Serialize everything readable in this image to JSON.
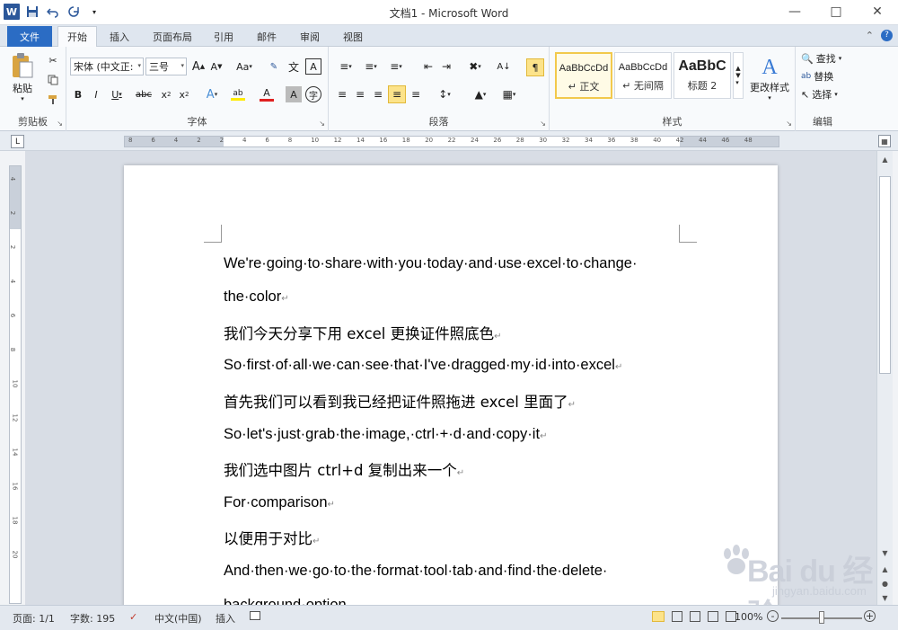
{
  "window": {
    "title": "文档1 - Microsoft Word"
  },
  "tabs": [
    {
      "label": "文件"
    },
    {
      "label": "开始"
    },
    {
      "label": "插入"
    },
    {
      "label": "页面布局"
    },
    {
      "label": "引用"
    },
    {
      "label": "邮件"
    },
    {
      "label": "审阅"
    },
    {
      "label": "视图"
    }
  ],
  "ribbon": {
    "clipboard": {
      "paste": "粘贴",
      "label": "剪贴板"
    },
    "font": {
      "family": "宋体 (中文正:",
      "size": "三号",
      "label": "字体",
      "case": "Aa"
    },
    "paragraph": {
      "label": "段落"
    },
    "styles": {
      "label": "样式",
      "items": [
        {
          "sample": "AaBbCcDd",
          "name": "↵ 正文"
        },
        {
          "sample": "AaBbCcDd",
          "name": "↵ 无间隔"
        },
        {
          "sample": "AaBbC",
          "name": "标题 2"
        }
      ],
      "change": "更改样式"
    },
    "editing": {
      "find": "查找",
      "replace": "替换",
      "select": "选择",
      "label": "编辑"
    }
  },
  "ruler": {
    "ticks": [
      "8",
      "6",
      "4",
      "2",
      "2",
      "4",
      "6",
      "8",
      "10",
      "12",
      "14",
      "16",
      "18",
      "20",
      "22",
      "24",
      "26",
      "28",
      "30",
      "32",
      "34",
      "36",
      "38",
      "40",
      "42",
      "44",
      "46",
      "48"
    ],
    "vticks": [
      "4",
      "2",
      "2",
      "4",
      "6",
      "8",
      "10",
      "12",
      "14",
      "16",
      "18",
      "20"
    ]
  },
  "document": {
    "lines": [
      "We're·going·to·share·with·you·today·and·use·excel·to·change·",
      "the·color",
      "我们今天分享下用 excel 更换证件照底色",
      "So·first·of·all·we·can·see·that·I've·dragged·my·id·into·excel",
      "首先我们可以看到我已经把证件照拖进 excel 里面了",
      "So·let's·just·grab·the·image,·ctrl·+·d·and·copy·it",
      "我们选中图片 ctrl+d  复制出来一个",
      "For·comparison",
      "以便用于对比",
      "And·then·we·go·to·the·format·tool·tab·and·find·the·delete·",
      "background·option"
    ],
    "para_mark": "↵"
  },
  "watermark": {
    "main": "Bai du 经验",
    "sub": "jingyan.baidu.com"
  },
  "status": {
    "page": "页面: 1/1",
    "words": "字数: 195",
    "language": "中文(中国)",
    "mode": "插入",
    "zoom": "100%"
  }
}
